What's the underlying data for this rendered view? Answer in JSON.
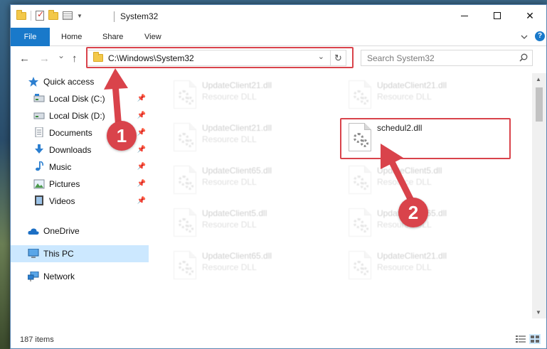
{
  "window": {
    "title": "System32",
    "buttons": {
      "minimize": "minimize",
      "maximize": "maximize",
      "close": "✕"
    }
  },
  "ribbon": {
    "tabs": [
      {
        "label": "File"
      },
      {
        "label": "Home"
      },
      {
        "label": "Share"
      },
      {
        "label": "View"
      }
    ],
    "help_label": "?"
  },
  "nav": {
    "back": "←",
    "forward": "→",
    "recent": "⌄",
    "up": "↑",
    "address": "C:\\Windows\\System32",
    "address_caret": "⌄",
    "refresh": "↻",
    "search_placeholder": "Search System32"
  },
  "sidebar": {
    "items": [
      {
        "label": "Quick access",
        "icon": "star-icon",
        "pinned": false
      },
      {
        "label": "Local Disk (C:)",
        "icon": "drive-icon",
        "pinned": true
      },
      {
        "label": "Local Disk (D:)",
        "icon": "drive-icon",
        "pinned": true
      },
      {
        "label": "Documents",
        "icon": "documents-icon",
        "pinned": true
      },
      {
        "label": "Downloads",
        "icon": "downloads-icon",
        "pinned": true
      },
      {
        "label": "Music",
        "icon": "music-icon",
        "pinned": true
      },
      {
        "label": "Pictures",
        "icon": "pictures-icon",
        "pinned": true
      },
      {
        "label": "Videos",
        "icon": "videos-icon",
        "pinned": true
      },
      {
        "label": "OneDrive",
        "icon": "cloud-icon",
        "pinned": false
      },
      {
        "label": "This PC",
        "icon": "computer-icon",
        "pinned": false,
        "selected": true
      },
      {
        "label": "Network",
        "icon": "network-icon",
        "pinned": false
      }
    ],
    "pin_glyph": "📌"
  },
  "files": [
    {
      "name": "UpdateClient21.dll",
      "type": "Resource DLL",
      "faded": true
    },
    {
      "name": "UpdateClient21.dll",
      "type": "Resource DLL",
      "faded": true
    },
    {
      "name": "UpdateClient21.dll",
      "type": "Resource DLL",
      "faded": true
    },
    {
      "name": "schedul2.dll",
      "type": "",
      "faded": false
    },
    {
      "name": "UpdateClient65.dll",
      "type": "Resource DLL",
      "faded": true
    },
    {
      "name": "UpdateClient5.dll",
      "type": "Resource DLL",
      "faded": true
    },
    {
      "name": "UpdateClient5.dll",
      "type": "Resource DLL",
      "faded": true
    },
    {
      "name": "UpdateClient65.dll",
      "type": "Resource DLL",
      "faded": true
    },
    {
      "name": "UpdateClient65.dll",
      "type": "Resource DLL",
      "faded": true
    },
    {
      "name": "UpdateClient21.dll",
      "type": "Resource DLL",
      "faded": true
    }
  ],
  "status": {
    "item_count": "187 items"
  },
  "annotations": {
    "step1": "1",
    "step2": "2",
    "color": "#d9434b"
  },
  "colors": {
    "accent": "#1979ca",
    "selected_bg": "#cce8ff",
    "highlight": "#d9434b"
  }
}
